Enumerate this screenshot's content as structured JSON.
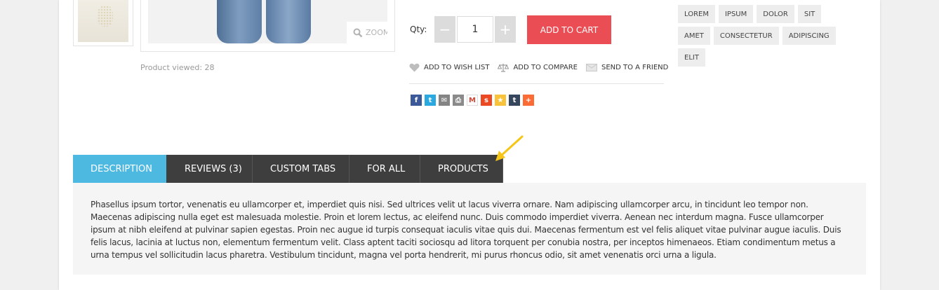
{
  "gallery": {
    "viewed_text": "Product viewed: 28",
    "zoom_label": "ZOOM"
  },
  "buy": {
    "qty_label": "Qty:",
    "qty_minus": "−",
    "qty_value": "1",
    "qty_plus": "+",
    "add_to_cart": "ADD TO CART"
  },
  "actions": {
    "wishlist": "ADD TO WISH LIST",
    "compare": "ADD TO COMPARE",
    "friend": "SEND TO A FRIEND"
  },
  "share": {
    "icons": [
      "facebook-icon",
      "twitter-icon",
      "email-icon",
      "print-icon",
      "gmail-icon",
      "stumbleupon-icon",
      "favorites-icon",
      "tumblr-icon",
      "addthis-icon"
    ],
    "glyphs": {
      "facebook": "f",
      "twitter": "t",
      "email": "✉",
      "print": "⎙",
      "gmail": "M",
      "stumbleupon": "s",
      "favorites": "★",
      "tumblr": "t",
      "addthis": "+"
    }
  },
  "tags": [
    "LOREM",
    "IPSUM",
    "DOLOR",
    "SIT",
    "AMET",
    "CONSECTETUR",
    "ADIPISCING",
    "ELIT"
  ],
  "tabs": [
    {
      "label": "DESCRIPTION",
      "active": true
    },
    {
      "label": "REVIEWS (3)",
      "active": false
    },
    {
      "label": "CUSTOM TABS",
      "active": false
    },
    {
      "label": "FOR ALL",
      "active": false
    },
    {
      "label": "PRODUCTS",
      "active": false
    }
  ],
  "description": "Phasellus ipsum tortor, venenatis eu ullamcorper et, imperdiet quis nisi. Sed ultrices velit ut lacus viverra ornare. Nam adipiscing ullamcorper arcu, in tincidunt leo tempor non. Maecenas adipiscing nulla eget est malesuada molestie. Proin et lorem lectus, ac eleifend nunc. Duis commodo imperdiet viverra. Aenean nec interdum magna. Fusce ullamcorper ipsum at nibh eleifend at pulvinar sapien egestas. Proin nec augue id turpis consequat iaculis vitae quis dui. Maecenas fermentum est vel felis aliquet vitae pulvinar augue iaculis. Duis felis lacus, lacinia at luctus non, elementum fermentum velit. Class aptent taciti sociosqu ad litora torquent per conubia nostra, per inceptos himenaeos. Etiam condimentum metus a urna tempus vel sollicitudin lacus pharetra. Vestibulum tincidunt, magna vel porta hendrerit, mi purus rhoncus odio, sit amet venenatis orci urna a ligula.",
  "colors": {
    "accent_tab": "#4db8e0",
    "cart_button": "#ea4d53",
    "tab_dark": "#3e3e3e",
    "arrow": "#f5c518"
  }
}
